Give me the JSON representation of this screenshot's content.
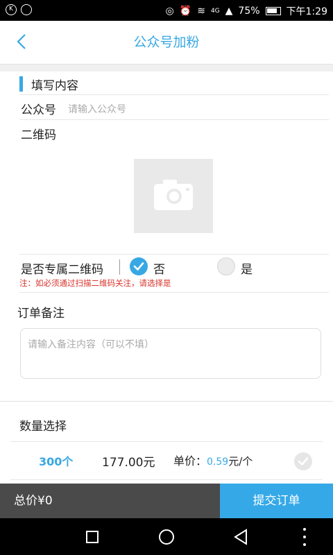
{
  "status_bar": {
    "left_icons": [
      "k-icon",
      "chat-icon"
    ],
    "battery": "75%",
    "time": "下午1:29",
    "network": "4G"
  },
  "header": {
    "title": "公众号加粉"
  },
  "form": {
    "section_title": "填写内容",
    "account_label": "公众号",
    "account_placeholder": "请输入公众号",
    "qrcode_label": "二维码",
    "exclusive_label": "是否专属二维码",
    "option_no": "否",
    "option_yes": "是",
    "note": "注：如必须通过扫描二维码关注，请选择是"
  },
  "remark": {
    "title": "订单备注",
    "placeholder": "请输入备注内容（可以不填）"
  },
  "quantity": {
    "title": "数量选择",
    "count": "300个",
    "price": "177.00元",
    "unit_label": "单价：",
    "unit_value": "0.59",
    "unit_suffix": "元/个"
  },
  "footer": {
    "total": "总价¥0",
    "submit": "提交订单"
  },
  "colors": {
    "accent": "#38a8e4",
    "note": "#d8322a",
    "footer_dark": "#4a4a4a"
  }
}
